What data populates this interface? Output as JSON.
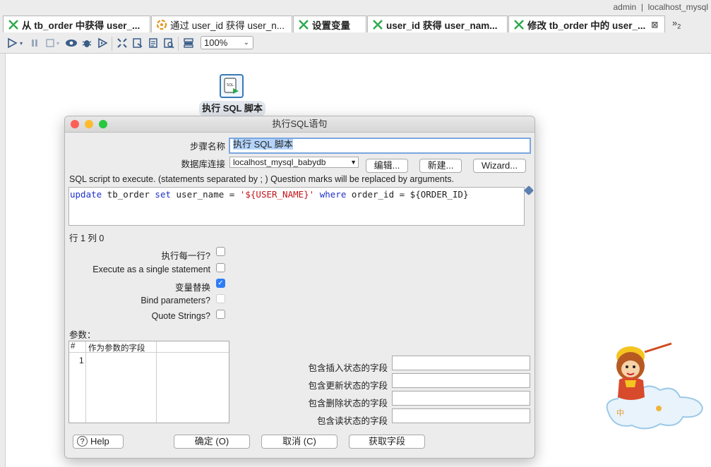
{
  "topbar": {
    "user": "admin",
    "separator": "|",
    "connection": "localhost_mysql"
  },
  "tabs": [
    {
      "label": "从 tb_order 中获得 user_...",
      "bold": true,
      "icon": "transformation-icon"
    },
    {
      "label": "通过 user_id 获得 user_n...",
      "bold": false,
      "icon": "job-icon"
    },
    {
      "label": "设置变量",
      "bold": true,
      "icon": "transformation-icon"
    },
    {
      "label": "user_id 获得 user_nam...",
      "bold": true,
      "icon": "transformation-icon"
    },
    {
      "label": "修改 tb_order 中的 user_...",
      "bold": true,
      "icon": "transformation-icon",
      "closable": true
    }
  ],
  "tab_overflow": {
    "symbol": "»",
    "count": "2"
  },
  "toolbar": {
    "zoom": "100%"
  },
  "canvas": {
    "step_label": "执行 SQL 脚本",
    "step_icon_text": "SQL"
  },
  "dialog": {
    "title": "执行SQL语句",
    "step_name_label": "步骤名称",
    "step_name_value": "执行 SQL 脚本",
    "db_connection_label": "数据库连接",
    "db_connection_value": "localhost_mysql_babydb",
    "edit_button": "编辑...",
    "new_button": "新建...",
    "wizard_button": "Wizard...",
    "sql_hint": "SQL script to execute. (statements separated by ; ) Question marks will be replaced by arguments.",
    "sql": {
      "kw_update": "update",
      "table": " tb_order ",
      "kw_set": "set",
      "assign": " user_name = ",
      "string": "'${USER_NAME}'",
      "space": " ",
      "kw_where": "where",
      "tail": " order_id = ${ORDER_ID}"
    },
    "cursor_pos": "行 1 列 0",
    "options": [
      {
        "label": "执行每一行?",
        "checked": false
      },
      {
        "label": "Execute as a single statement",
        "checked": false
      },
      {
        "label": "变量替换",
        "checked": true
      },
      {
        "label": "Bind parameters?",
        "checked": false
      },
      {
        "label": "Quote Strings?",
        "checked": false
      }
    ],
    "params_label": "参数：",
    "params_table": {
      "col_num": "#",
      "col_field": "作为参数的字段",
      "rows": [
        "1"
      ]
    },
    "status_fields": [
      {
        "label": "包含插入状态的字段",
        "value": ""
      },
      {
        "label": "包含更新状态的字段",
        "value": ""
      },
      {
        "label": "包含删除状态的字段",
        "value": ""
      },
      {
        "label": "包含读状态的字段",
        "value": ""
      }
    ],
    "help_button": "Help",
    "ok_button": "确定 (O)",
    "cancel_button": "取消 (C)",
    "get_fields_button": "获取字段"
  },
  "colors": {
    "keyword": "#1f30c8",
    "string": "#c0141b",
    "checkbox_checked": "#2f7df6",
    "selection": "#b3d3fb"
  }
}
